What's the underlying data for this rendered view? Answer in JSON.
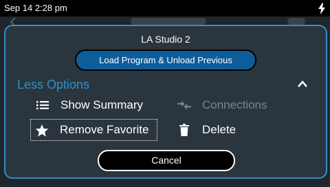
{
  "status_bar": {
    "time": "Sep 14 2:28 pm",
    "charging_icon": "bolt-icon"
  },
  "dialog": {
    "title": "LA Studio 2",
    "load_button_label": "Load Program & Unload Previous",
    "less_options_label": "Less Options",
    "options": [
      {
        "label": "Show Summary",
        "icon": "list-icon",
        "enabled": true
      },
      {
        "label": "Connections",
        "icon": "connections-icon",
        "enabled": false
      },
      {
        "label": "Remove Favorite",
        "icon": "star-icon",
        "enabled": true,
        "focused": true
      },
      {
        "label": "Delete",
        "icon": "trash-icon",
        "enabled": true
      }
    ],
    "cancel_label": "Cancel"
  },
  "colors": {
    "accent": "#2f91d1",
    "primary_button": "#0e5d9b",
    "dialog_bg": "#2b353d",
    "disabled_text": "#7d868d"
  }
}
